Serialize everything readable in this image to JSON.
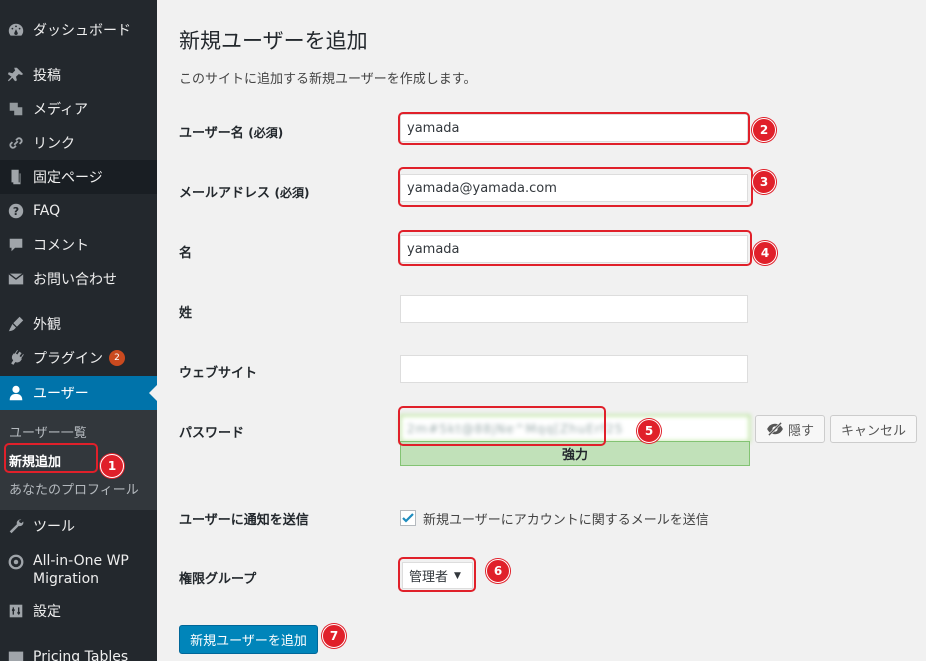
{
  "sidebar": {
    "menu": [
      {
        "label": "ダッシュボード",
        "icon": "dashboard-icon"
      },
      {
        "label": "投稿",
        "icon": "pin-icon"
      },
      {
        "label": "メディア",
        "icon": "media-icon"
      },
      {
        "label": "リンク",
        "icon": "link-icon"
      },
      {
        "label": "固定ページ",
        "icon": "page-icon"
      },
      {
        "label": "FAQ",
        "icon": "help-icon"
      },
      {
        "label": "コメント",
        "icon": "comment-icon"
      },
      {
        "label": "お問い合わせ",
        "icon": "mail-icon"
      },
      {
        "label": "外観",
        "icon": "brush-icon"
      },
      {
        "label": "プラグイン",
        "icon": "plugin-icon",
        "badge": "2"
      },
      {
        "label": "ユーザー",
        "icon": "user-icon"
      },
      {
        "label": "ツール",
        "icon": "wrench-icon"
      },
      {
        "label_line1": "All-in-One WP",
        "label_line2": "Migration",
        "icon": "migration-icon"
      },
      {
        "label": "設定",
        "icon": "settings-icon"
      },
      {
        "label": "Pricing Tables",
        "icon": "table-icon"
      }
    ],
    "submenu": [
      "ユーザー一覧",
      "新規追加",
      "あなたのプロフィール"
    ]
  },
  "page": {
    "title": "新規ユーザーを追加",
    "description": "このサイトに追加する新規ユーザーを作成します。"
  },
  "form": {
    "username": {
      "label": "ユーザー名",
      "required": "(必須)",
      "value": "yamada"
    },
    "email": {
      "label": "メールアドレス",
      "required": "(必須)",
      "value": "yamada@yamada.com"
    },
    "first_name": {
      "label": "名",
      "value": "yamada"
    },
    "last_name": {
      "label": "姓",
      "value": ""
    },
    "website": {
      "label": "ウェブサイト",
      "value": ""
    },
    "password": {
      "label": "パスワード",
      "value": "2m#5kt@88jNe^Mqq[ZhuErf25",
      "strength": "強力",
      "hide_label": "隠す",
      "cancel_label": "キャンセル"
    },
    "notify": {
      "label": "ユーザーに通知を送信",
      "checkbox_label": "新規ユーザーにアカウントに関するメールを送信",
      "checked": true
    },
    "role": {
      "label": "権限グループ",
      "value": "管理者"
    },
    "submit_label": "新規ユーザーを追加"
  },
  "callouts": [
    "1",
    "2",
    "3",
    "4",
    "5",
    "6",
    "7"
  ],
  "colors": {
    "sidebar_bg": "#23282d",
    "active": "#0073aa",
    "callout": "#e0202a",
    "primary_button": "#0085ba",
    "strength_bg": "#c1e1b9"
  }
}
